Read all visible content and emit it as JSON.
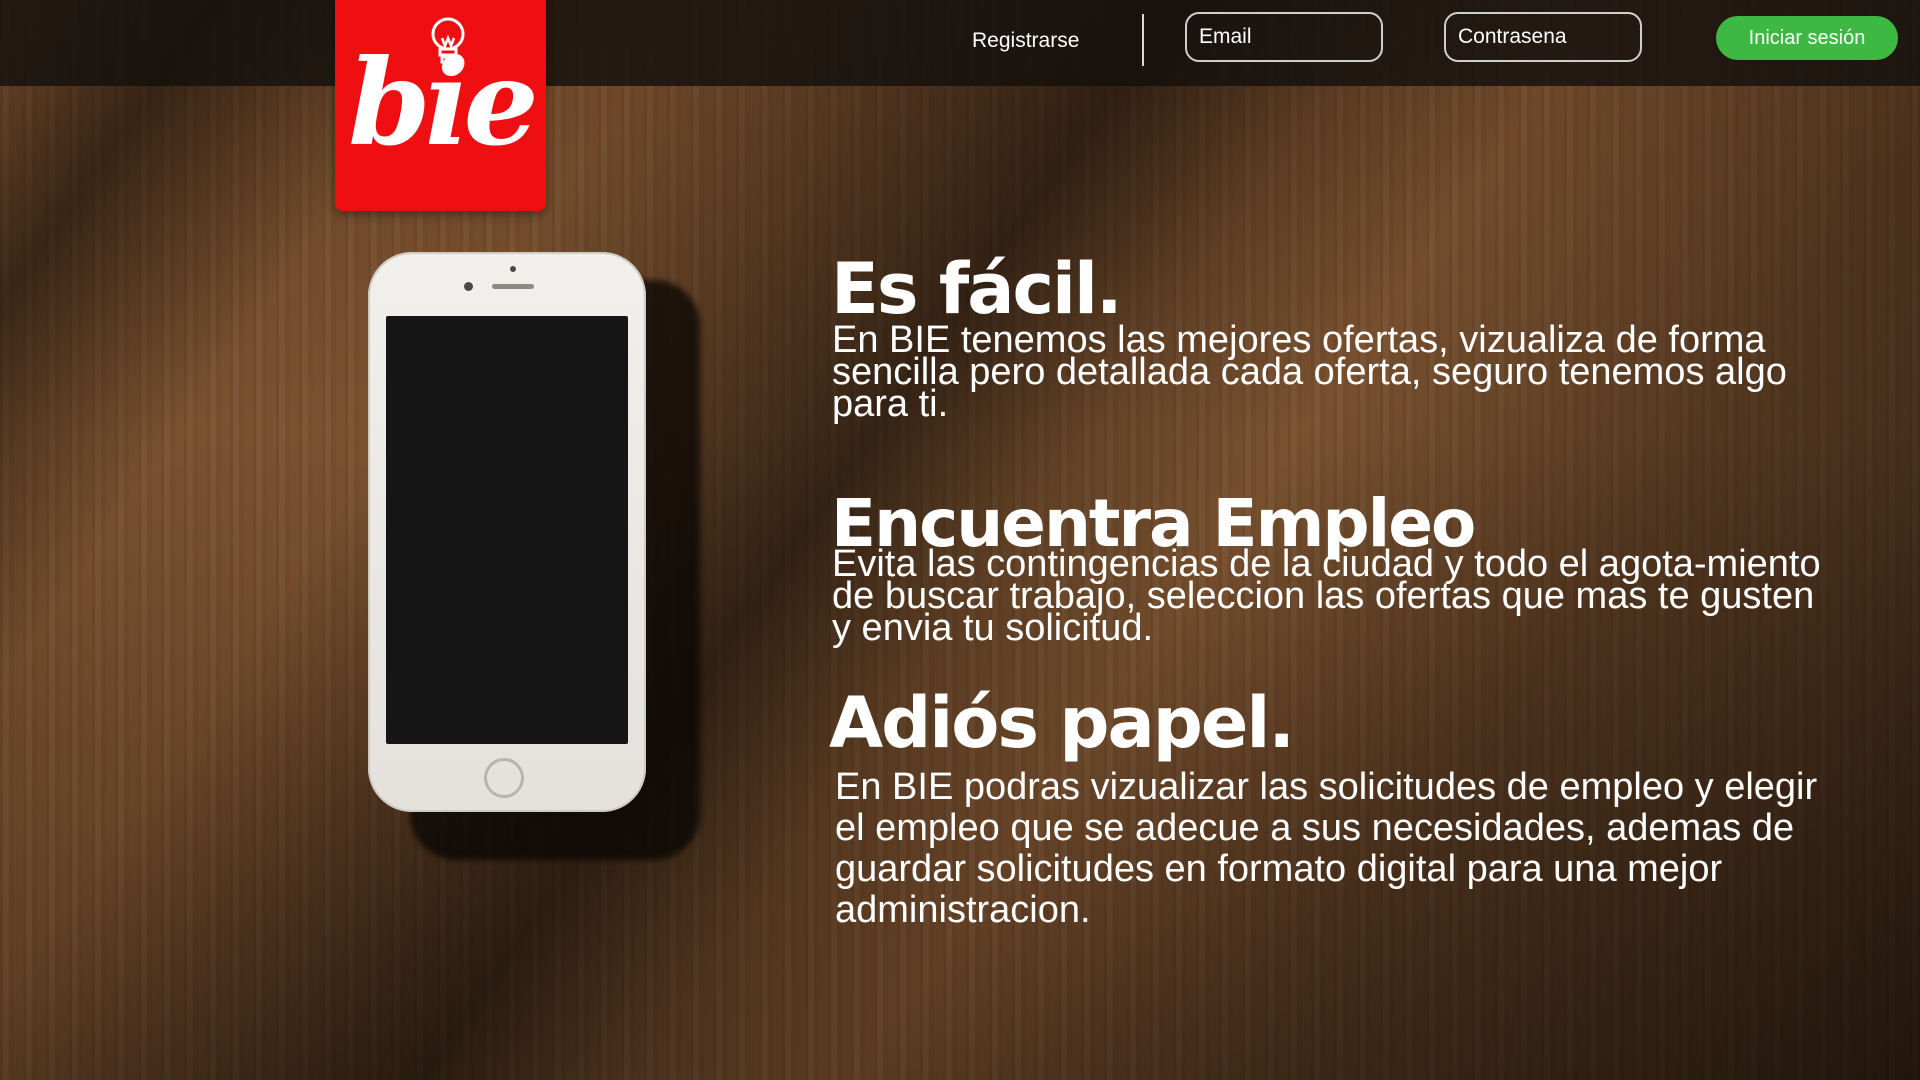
{
  "brand": {
    "logo_text": "bie",
    "logo_color": "#ef0f12"
  },
  "header": {
    "register_label": "Registrarse",
    "email_placeholder": "Email",
    "password_placeholder": "Contrasena",
    "login_label": "Iniciar sesión",
    "login_color": "#3cb843"
  },
  "sections": [
    {
      "title": "Es fácil.",
      "body": "En BIE tenemos las mejores ofertas, vizualiza de forma sencilla pero detallada cada oferta, seguro tenemos algo para ti."
    },
    {
      "title": "Encuentra Empleo",
      "body": "Evita las contingencias de la ciudad y todo el agota-miento de buscar trabajo, seleccion las ofertas que mas te gusten y envia tu solicitud."
    },
    {
      "title": "Adiós papel.",
      "body": "En BIE podras vizualizar las solicitudes de empleo y elegir el empleo que se adecue a sus necesidades, ademas de guardar solicitudes en formato digital para una mejor administracion."
    }
  ]
}
